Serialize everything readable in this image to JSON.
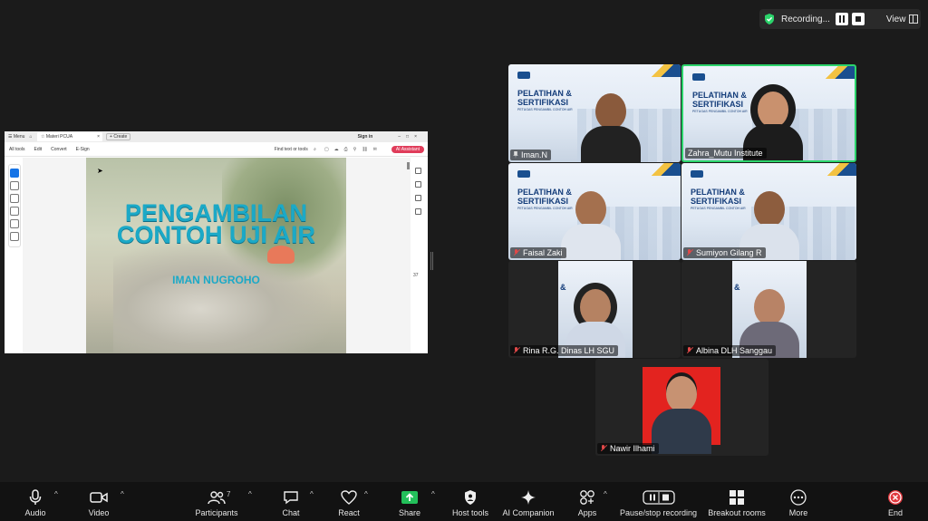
{
  "recording": {
    "label": "Recording...",
    "view_label": "View"
  },
  "share": {
    "menu_label": "Menu",
    "tab_label": "Materi PCUA",
    "create_label": "Create",
    "sign_in_label": "Sign in",
    "toolbar": [
      "All tools",
      "Edit",
      "Convert",
      "E-Sign"
    ],
    "find_label": "Find text or tools",
    "ai_label": "AI Assistant",
    "page_number": "37",
    "slide": {
      "title_line1": "PENGAMBILAN",
      "title_line2": "CONTOH UJI AIR",
      "author": "IMAN NUGROHO"
    }
  },
  "banner": {
    "line1": "PELATIHAN &",
    "line2": "SERTIFIKASI",
    "line3": "PETUGAS PENGAMBIL CONTOH AIR"
  },
  "participants_tiles": [
    {
      "name": "Iman.N"
    },
    {
      "name": "Zahra_Mutu Institute"
    },
    {
      "name": "Faisal Zaki"
    },
    {
      "name": "Sumiyon Gilang R"
    },
    {
      "name": "Rina R.G. Dinas LH SGU"
    },
    {
      "name": "Albina DLH Sanggau"
    },
    {
      "name": "Nawir Ilhami"
    }
  ],
  "toolbar": {
    "audio": "Audio",
    "video": "Video",
    "participants": "Participants",
    "participants_count": "7",
    "chat": "Chat",
    "react": "React",
    "share": "Share",
    "host_tools": "Host tools",
    "ai_companion": "AI Companion",
    "apps": "Apps",
    "pause_stop": "Pause/stop recording",
    "breakout": "Breakout rooms",
    "more": "More",
    "end": "End"
  },
  "colors": {
    "accent_green": "#2bd46b",
    "share_green": "#23c05a",
    "end_red": "#e0383e",
    "slide_title": "#1ba9c7"
  }
}
